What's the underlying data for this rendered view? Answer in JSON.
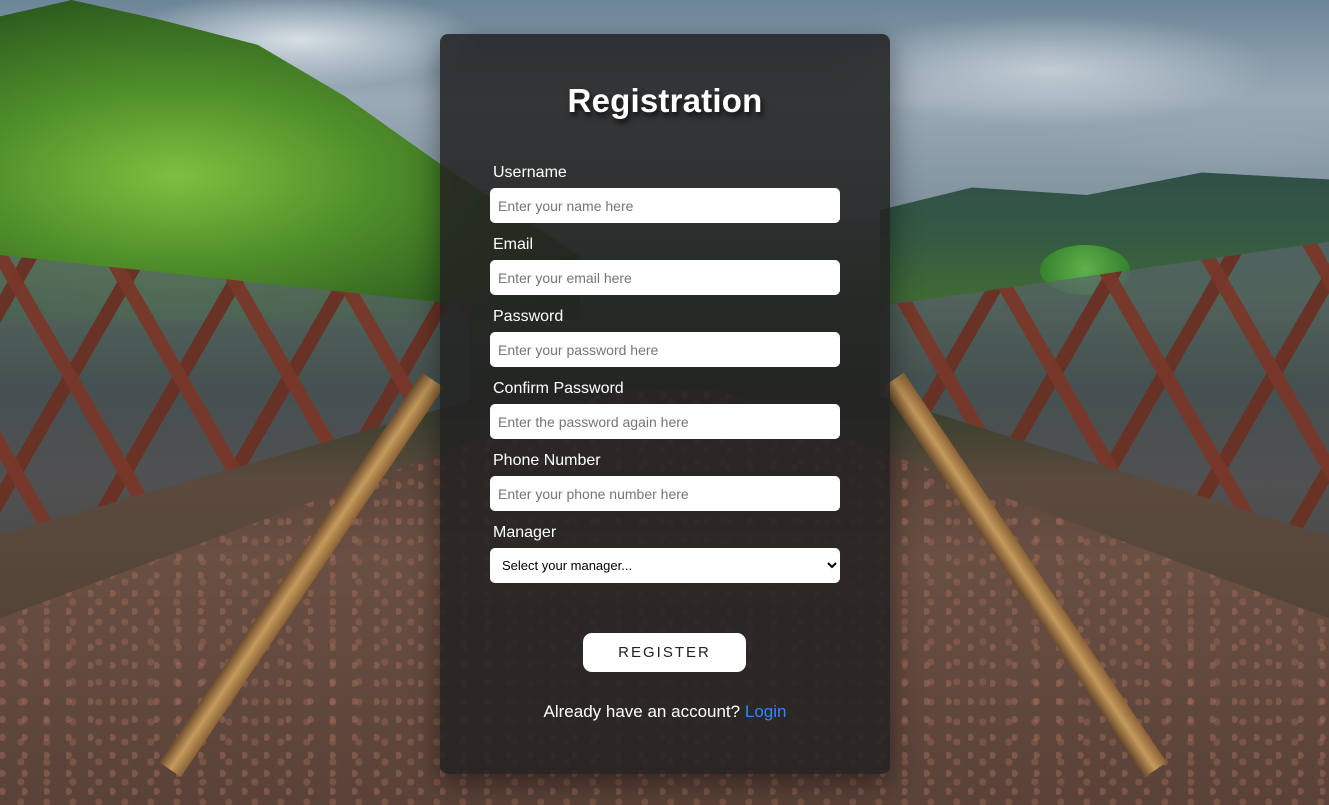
{
  "form": {
    "title": "Registration",
    "fields": [
      {
        "label": "Username",
        "placeholder": "Enter your name here",
        "value": ""
      },
      {
        "label": "Email",
        "placeholder": "Enter your email here",
        "value": ""
      },
      {
        "label": "Password",
        "placeholder": "Enter your password here",
        "value": ""
      },
      {
        "label": "Confirm Password",
        "placeholder": "Enter the password again here",
        "value": ""
      },
      {
        "label": "Phone Number",
        "placeholder": "Enter your phone number here",
        "value": ""
      }
    ],
    "manager": {
      "label": "Manager",
      "selected": "Select your manager..."
    },
    "register_label": "REGISTER",
    "footer_prompt": "Already have an account?",
    "login_label": "Login"
  },
  "colors": {
    "card_background": "#222222",
    "link": "#2f86ff",
    "text": "#ffffff"
  }
}
